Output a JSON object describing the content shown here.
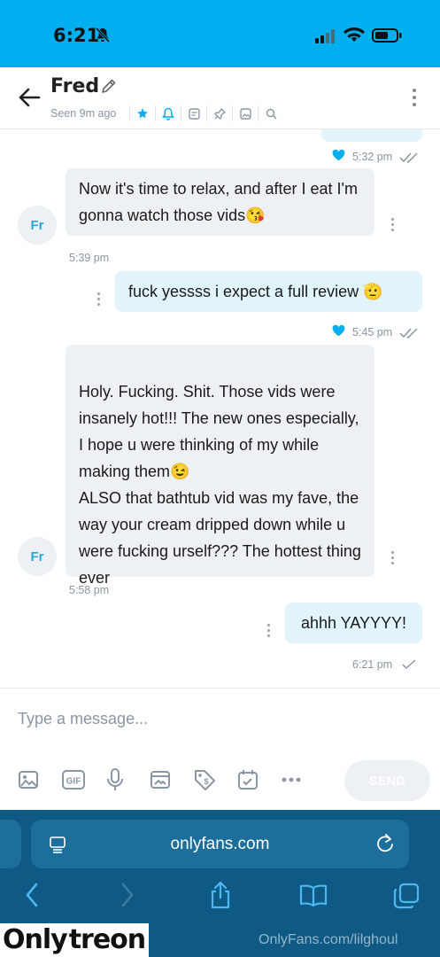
{
  "status_bar": {
    "time": "6:21"
  },
  "header": {
    "name": "Fred",
    "seen": "Seen 9m ago",
    "icons": [
      "star-icon",
      "bell-icon",
      "notes-icon",
      "pin-icon",
      "image-icon",
      "search-icon"
    ]
  },
  "messages": [
    {
      "side": "out",
      "time": "5:32 pm",
      "liked": true,
      "read": "double"
    },
    {
      "side": "in",
      "avatar": "Fr",
      "text": "Now it's time to relax, and after I eat I'm gonna watch those vids😘",
      "time": "5:39 pm"
    },
    {
      "side": "out",
      "text": "fuck yessss i expect a full review 🫡",
      "time": "5:45 pm",
      "liked": true,
      "read": "double"
    },
    {
      "side": "in",
      "avatar": "Fr",
      "text": "Holy. Fucking. Shit. Those vids were insanely hot!!! The new ones especially, I hope u were thinking of my while making them😉\nALSO that bathtub vid was my fave, the way your cream dripped down while u were fucking urself??? The hottest thing ever",
      "time": "5:58 pm"
    },
    {
      "side": "out",
      "text": "ahhh YAYYYY!",
      "time": "6:21 pm",
      "read": "single"
    }
  ],
  "composer": {
    "placeholder": "Type a message...",
    "send_label": "SEND",
    "tools": [
      "image-icon",
      "gif-icon",
      "microphone-icon",
      "media-vault-icon",
      "price-tag-icon",
      "calendar-icon",
      "more-icon"
    ],
    "gif_label": "GIF"
  },
  "browser": {
    "url": "onlyfans.com"
  },
  "watermark": {
    "logo_a": "Only",
    "logo_b": "treon",
    "credit": "OnlyFans.com/lilghoul"
  }
}
